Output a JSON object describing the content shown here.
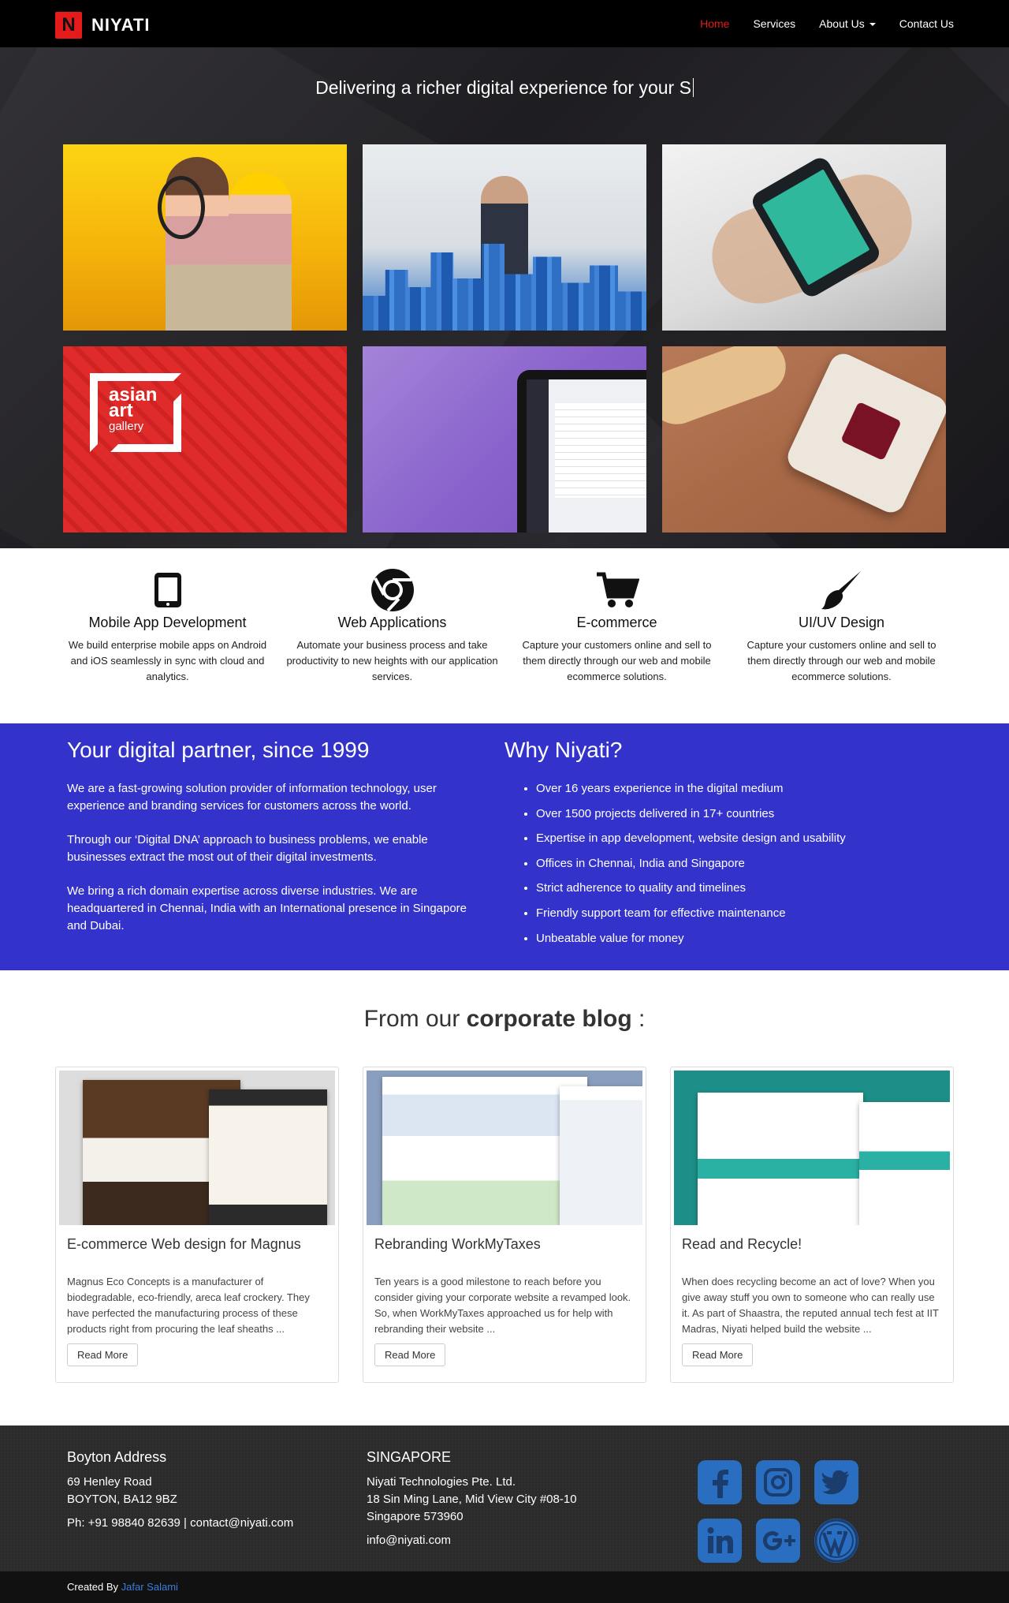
{
  "nav": {
    "brand_letter": "N",
    "brand_name": "NIYATI",
    "links": [
      "Home",
      "Services",
      "About Us",
      "Contact Us"
    ]
  },
  "hero": {
    "tagline": "Delivering a richer digital experience for your S",
    "tile_logo_text": "asian",
    "tile_logo_text2": "art",
    "tile_logo_text3": "gallery"
  },
  "services": [
    {
      "icon": "tablet-icon",
      "title": "Mobile App Development",
      "text": "We build enterprise mobile apps on Android and iOS seamlessly in sync with cloud and analytics."
    },
    {
      "icon": "chrome-icon",
      "title": "Web Applications",
      "text": "Automate your business process and take productivity to new heights with our application services."
    },
    {
      "icon": "shopping-cart-icon",
      "title": "E-commerce",
      "text": "Capture your customers online and sell to them directly through our web and mobile ecommerce solutions."
    },
    {
      "icon": "paint-brush-icon",
      "title": "UI/UV Design",
      "text": "Capture your customers online and sell to them directly through our web and mobile ecommerce solutions."
    }
  ],
  "partner": {
    "title": "Your digital partner, since 1999",
    "paragraphs": [
      "We are a fast-growing solution provider of information technology, user experience and branding services for customers across the world.",
      "Through our ‘Digital DNA’ approach to business problems, we enable businesses extract the most out of their digital investments.",
      "We bring a rich domain expertise across diverse industries. We are headquartered in Chennai, India with an International presence in Singapore and Dubai."
    ]
  },
  "why": {
    "title": "Why Niyati?",
    "items": [
      "Over 16 years experience in the digital medium",
      "Over 1500 projects delivered in 17+ countries",
      "Expertise in app development, website design and usability",
      "Offices in Chennai, India and Singapore",
      "Strict adherence to quality and timelines",
      "Friendly support team for effective maintenance",
      "Unbeatable value for money"
    ]
  },
  "blog": {
    "title_prefix": "From our ",
    "title_bold": "corporate blog",
    "title_suffix": " :",
    "posts": [
      {
        "title": "E-commerce Web design for Magnus",
        "excerpt": "Magnus Eco Concepts is a manufacturer of biodegradable, eco-friendly, areca leaf crockery. They have perfected the manufacturing process of these products right from procuring the leaf sheaths ...",
        "button": "Read More"
      },
      {
        "title": "Rebranding WorkMyTaxes",
        "excerpt": "Ten years is a good milestone to reach before you consider giving your corporate website a revamped look. So, when WorkMyTaxes approached us for help with rebranding their website ...",
        "button": "Read More"
      },
      {
        "title": "Read and Recycle!",
        "excerpt": "When does recycling become an act of love? When you give away stuff you own to someone who can really use it. As part of Shaastra, the reputed annual tech fest at IIT Madras, Niyati helped build the website ...",
        "button": "Read More"
      }
    ]
  },
  "footer": {
    "col1": {
      "title": "Boyton Address",
      "line1": "69 Henley Road",
      "line2": "BOYTON, BA12 9BZ",
      "contact": "Ph: +91 98840 82639 | contact@niyati.com"
    },
    "col2": {
      "title": "SINGAPORE",
      "line1": "Niyati Technologies Pte. Ltd.",
      "line2": "18 Sin Ming Lane, Mid View City #08-10",
      "line3": "Singapore 573960",
      "email": "info@niyati.com"
    },
    "social": [
      "facebook-icon",
      "instagram-icon",
      "twitter-icon",
      "linkedin-icon",
      "google-plus-icon",
      "wordpress-icon"
    ]
  },
  "copyright": {
    "prefix": "Created By ",
    "author": "Jafar Salami"
  },
  "colors": {
    "accent_red": "#e51a1a",
    "partner_blue": "#3333cc",
    "social_blue": "#2a6ec2",
    "link_blue": "#3b7cdc"
  }
}
